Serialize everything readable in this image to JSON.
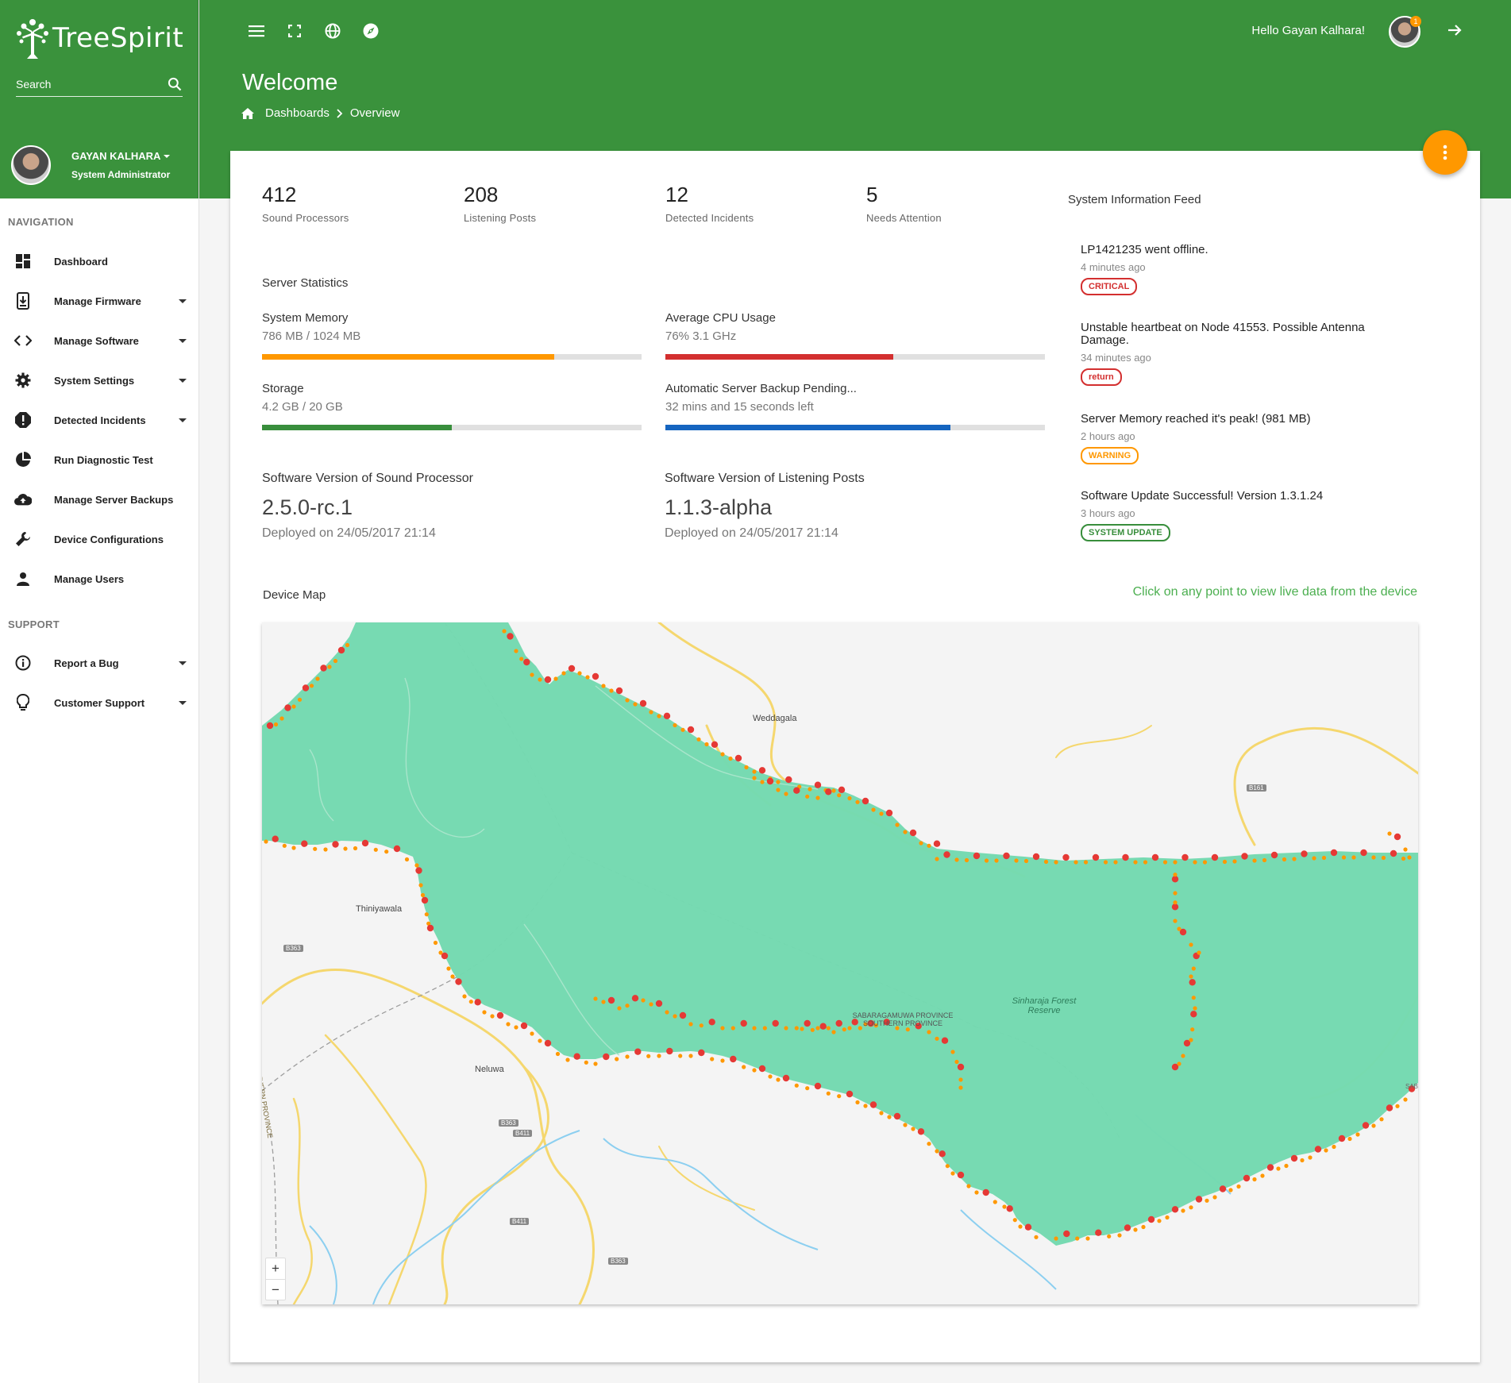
{
  "app": {
    "name": "TreeSpirit"
  },
  "search": {
    "placeholder": "Search"
  },
  "user": {
    "name": "GAYAN KALHARA",
    "role": "System Administrator"
  },
  "navigation": {
    "title": "NAVIGATION",
    "items": [
      {
        "label": "Dashboard",
        "icon": "dashboard-icon",
        "has_submenu": false
      },
      {
        "label": "Manage Firmware",
        "icon": "firmware-icon",
        "has_submenu": true
      },
      {
        "label": "Manage Software",
        "icon": "code-icon",
        "has_submenu": true
      },
      {
        "label": "System Settings",
        "icon": "gear-icon",
        "has_submenu": true
      },
      {
        "label": "Detected Incidents",
        "icon": "alert-icon",
        "has_submenu": true
      },
      {
        "label": "Run Diagnostic Test",
        "icon": "pie-chart-icon",
        "has_submenu": false
      },
      {
        "label": "Manage Server Backups",
        "icon": "cloud-upload-icon",
        "has_submenu": false
      },
      {
        "label": "Device Configurations",
        "icon": "wrench-icon",
        "has_submenu": false
      },
      {
        "label": "Manage Users",
        "icon": "person-icon",
        "has_submenu": false
      }
    ]
  },
  "support": {
    "title": "SUPPORT",
    "items": [
      {
        "label": "Report a Bug",
        "icon": "info-icon",
        "has_submenu": true
      },
      {
        "label": "Customer Support",
        "icon": "lightbulb-icon",
        "has_submenu": true
      }
    ]
  },
  "header": {
    "greeting": "Hello Gayan Kalhara!",
    "notification_count": "1",
    "title": "Welcome",
    "breadcrumb": [
      "Dashboards",
      "Overview"
    ]
  },
  "stats": [
    {
      "value": "412",
      "label": "Sound Processors"
    },
    {
      "value": "208",
      "label": "Listening Posts"
    },
    {
      "value": "12",
      "label": "Detected Incidents"
    },
    {
      "value": "5",
      "label": "Needs Attention"
    }
  ],
  "server_statistics": {
    "title": "Server Statistics",
    "metrics": [
      {
        "name": "System Memory",
        "value": "786 MB / 1024 MB",
        "fraction": 0.77,
        "color": "#ff9800"
      },
      {
        "name": "Average CPU Usage",
        "value": "76% 3.1 GHz",
        "fraction": 0.6,
        "color": "#d32f2f"
      },
      {
        "name": "Storage",
        "value": "4.2 GB / 20 GB",
        "fraction": 0.5,
        "color": "#388e3c"
      },
      {
        "name": "Automatic Server Backup Pending...",
        "value": "32 mins and 15 seconds left",
        "fraction": 0.75,
        "color": "#1565c0"
      }
    ]
  },
  "versions": [
    {
      "title": "Software Version of Sound Processor",
      "version": "2.5.0-rc.1",
      "deployed": "Deployed on 24/05/2017 21:14"
    },
    {
      "title": "Software Version of Listening Posts",
      "version": "1.1.3-alpha",
      "deployed": "Deployed on 24/05/2017 21:14"
    }
  ],
  "feed": {
    "title": "System Information Feed",
    "items": [
      {
        "text": "LP1421235 went offline.",
        "time": "4 minutes ago",
        "tag": "CRITICAL",
        "color": "#d32f2f"
      },
      {
        "text": "Unstable heartbeat on Node 41553. Possible Antenna Damage.",
        "time": "34 minutes ago",
        "tag": "return",
        "color": "#d32f2f"
      },
      {
        "text": "Server Memory reached it's peak! (981 MB)",
        "time": "2 hours ago",
        "tag": "WARNING",
        "color": "#ff9800"
      },
      {
        "text": "Software Update Successful! Version 1.3.1.24",
        "time": "3 hours ago",
        "tag": "SYSTEM UPDATE",
        "color": "#388e3c"
      }
    ]
  },
  "map": {
    "title": "Device Map",
    "hint": "Click on any point to view live data from the device",
    "labels": {
      "weddagala": "Weddagala",
      "thiniyawala": "Thiniyawala",
      "neluwa": "Neluwa",
      "sinharaja": "Sinharaja Forest Reserve",
      "province": "SABARAGAMUWA PROVINCE SOUTHERN PROVINCE",
      "southern": "SOUTHERN PROVINCE",
      "b161": "B161",
      "b363": "B363",
      "b363b": "B363",
      "b411": "B411",
      "b411b": "B411",
      "b363c": "B363",
      "sab": "SAB"
    },
    "zoom_in": "+",
    "zoom_out": "−",
    "colors": {
      "forest": "#74d9b0",
      "critical": "#e53935",
      "warning": "#ff9800"
    }
  }
}
